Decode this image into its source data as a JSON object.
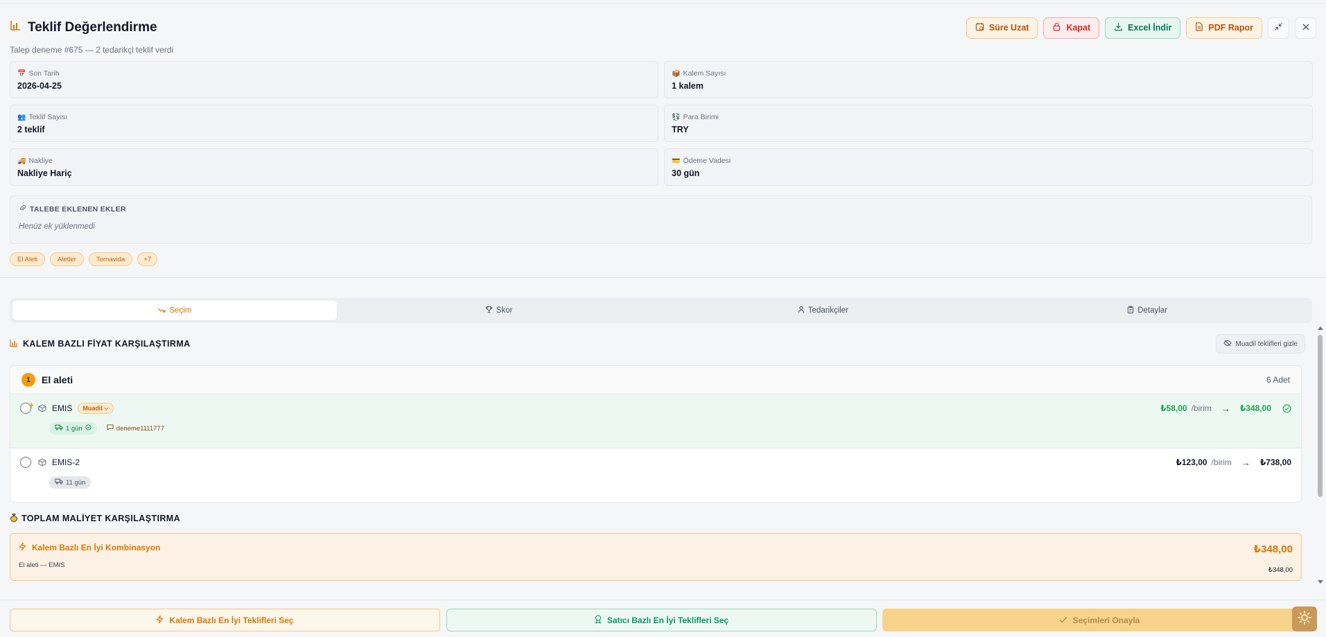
{
  "header": {
    "title": "Teklif Değerlendirme",
    "subtitle": "Talep deneme #675 — 2 tedarikçi teklif verdi",
    "actions": {
      "extend": "Süre Uzat",
      "close": "Kapat",
      "excel": "Excel İndir",
      "pdf": "PDF Rapor"
    }
  },
  "info": [
    {
      "icon": "📅",
      "label": "Son Tarih",
      "value": "2026-04-25"
    },
    {
      "icon": "📦",
      "label": "Kalem Sayısı",
      "value": "1 kalem"
    },
    {
      "icon": "👥",
      "label": "Teklif Sayısı",
      "value": "2 teklif"
    },
    {
      "icon": "💱",
      "label": "Para Birimi",
      "value": "TRY"
    },
    {
      "icon": "🚚",
      "label": "Nakliye",
      "value": "Nakliye Hariç"
    },
    {
      "icon": "💳",
      "label": "Ödeme Vadesi",
      "value": "30 gün"
    }
  ],
  "attachments": {
    "heading": "TALEBE EKLENEN EKLER",
    "empty": "Henüz ek yüklenmedi"
  },
  "tags": [
    "El Aleti",
    "Aletler",
    "Tornavida",
    "+7"
  ],
  "tabs": [
    {
      "label": "Seçim",
      "icon": "trend-icon",
      "active": true
    },
    {
      "label": "Skor",
      "icon": "trophy-icon",
      "active": false
    },
    {
      "label": "Tedarikçiler",
      "icon": "user-icon",
      "active": false
    },
    {
      "label": "Detaylar",
      "icon": "clipboard-icon",
      "active": false
    }
  ],
  "comparison": {
    "title": "KALEM BAZLI FİYAT KARŞILAŞTIRMA",
    "hide_button": "Muadil teklifleri gizle",
    "item": {
      "number": "1",
      "name": "El aleti",
      "qty": "6 Adet"
    },
    "offers": [
      {
        "supplier": "EMIS",
        "badge": "Muadil",
        "unit_price": "₺58,00",
        "per": "/birim",
        "arrow": "→",
        "total": "₺348,00",
        "delivery": "1 gün",
        "note": "deneme1111777",
        "selected": true
      },
      {
        "supplier": "EMIS-2",
        "unit_price": "₺123,00",
        "per": "/birim",
        "arrow": "→",
        "total": "₺738,00",
        "delivery": "11 gün",
        "selected": false
      }
    ]
  },
  "total": {
    "title": "TOPLAM MALİYET KARŞILAŞTIRMA",
    "combo_title": "Kalem Bazlı En İyi Kombinasyon",
    "combo_amount": "₺348,00",
    "line_label": "El aleti — ",
    "line_supplier": "EMIS",
    "line_amount": "₺348,00"
  },
  "footer": {
    "best_item": "Kalem Bazlı En İyi Teklifleri Seç",
    "best_supplier": "Satıcı Bazlı En İyi Teklifleri Seç",
    "confirm": "Seçimleri Onayla"
  },
  "colors": {
    "accent": "#d97706",
    "green": "#16a34a",
    "red": "#dc2626"
  }
}
